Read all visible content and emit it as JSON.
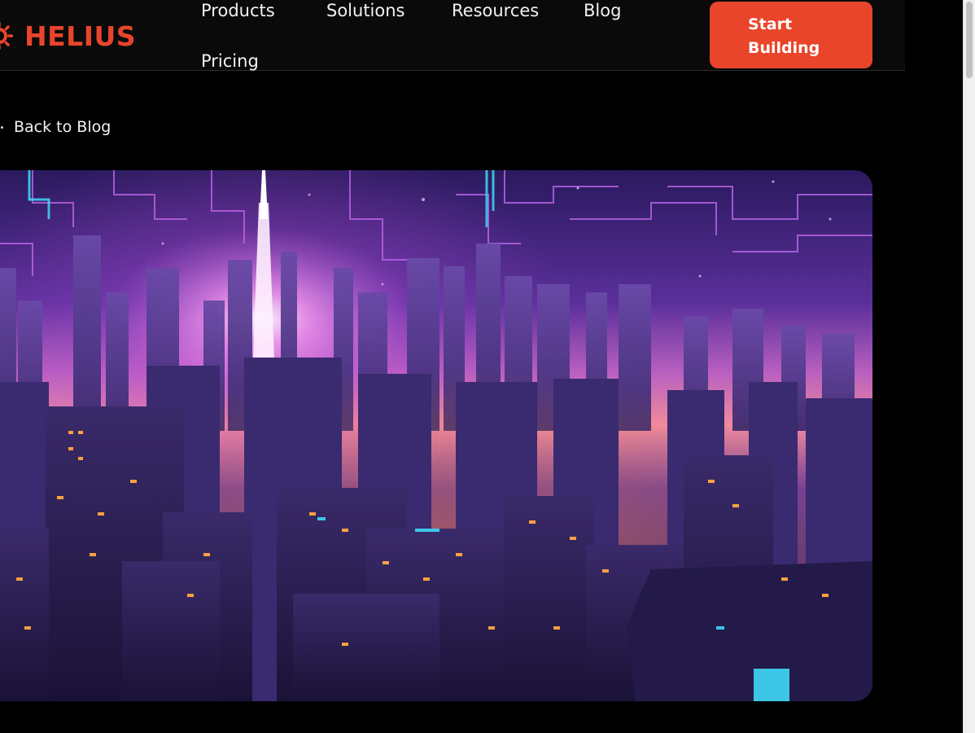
{
  "brand": {
    "name": "HELIUS",
    "color": "#e8452a",
    "icon": "helius-sun-logo-icon"
  },
  "nav": {
    "items": [
      {
        "label": "Products"
      },
      {
        "label": "Solutions"
      },
      {
        "label": "Resources"
      },
      {
        "label": "Blog"
      },
      {
        "label": "Pricing"
      }
    ],
    "cta_line1": "Start",
    "cta_line2": "Building"
  },
  "back_link": {
    "label": "Back to Blog",
    "icon": "arrow-left-icon"
  },
  "hero": {
    "description": "cover-image",
    "palette": {
      "sky_top": "#2a1a5e",
      "sky_mid": "#7a3fb5",
      "horizon": "#f08aa0",
      "city_dark": "#1e1540",
      "window_glow": "#ffa040",
      "beam": "#ff7ef0",
      "circuit": "#c46cf0",
      "cyan": "#3fd8f5"
    }
  },
  "colors": {
    "background": "#000000",
    "header_bg": "#0a0a0a",
    "text": "#f2f2f2"
  }
}
